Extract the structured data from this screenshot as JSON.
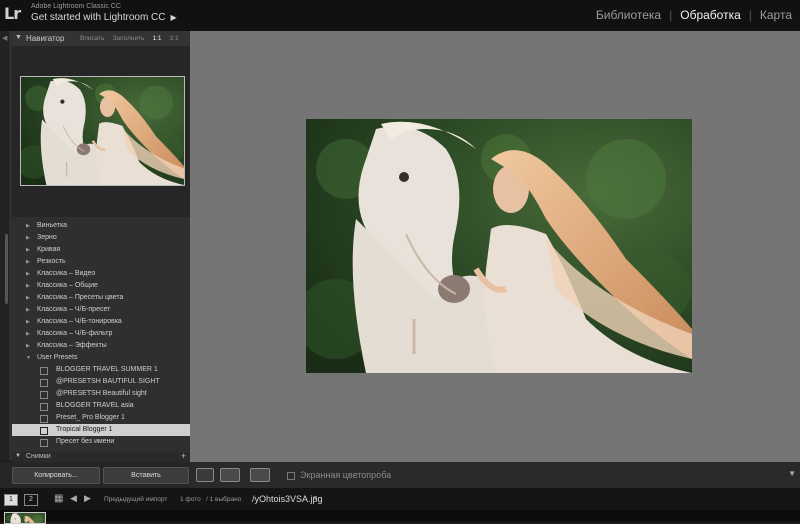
{
  "app": {
    "name": "Adobe Lightroom Classic CC",
    "logo": "Lr",
    "get_started": "Get started with Lightroom CC",
    "get_started_arrow": "▶"
  },
  "modules": [
    "Библиотека",
    "Обработка",
    "Карта"
  ],
  "navigator": {
    "title": "Навигатор",
    "options": [
      "Вписать",
      "Заполнить",
      "1:1",
      "3:1"
    ]
  },
  "presets": {
    "folders": [
      "Виньетка",
      "Зерно",
      "Кривая",
      "Резкость",
      "Классика – Видео",
      "Классика – Общие",
      "Классика – Пресеты цвета",
      "Классика – Ч/Б-пресет",
      "Классика – Ч/Б-тонировка",
      "Классика – Ч/Б-фильтр",
      "Классика – Эффекты",
      "User Presets"
    ],
    "user_items": [
      "BLOGGER TRAVEL SUMMER 1",
      "@PRESETSH BAUTIFUL SIGHT",
      "@PRESETSH Beautiful sight",
      "BLOGGER TRAVEL asia",
      "Preset_ Pro Blogger 1",
      "Tropical Blogger 1",
      "Пресет без имени"
    ]
  },
  "snapshots": {
    "title": "Снимки",
    "plus": "+"
  },
  "buttons": {
    "copy": "Копировать...",
    "paste": "Вставить"
  },
  "toolbar": {
    "softproof_label": "Экранная цветопроба",
    "arrow": "▼"
  },
  "filmstrip": {
    "page1": "1",
    "page2": "2",
    "source": "Предыдущий импорт",
    "count": "1 фото",
    "selected": "/ 1 выбрано",
    "filename": "/yOhtois3VSA.jpg",
    "dropdown": "▼"
  },
  "colors": {
    "accent": "#f2f2f2",
    "panel": "#2f2f2f",
    "canvas": "#757575"
  }
}
